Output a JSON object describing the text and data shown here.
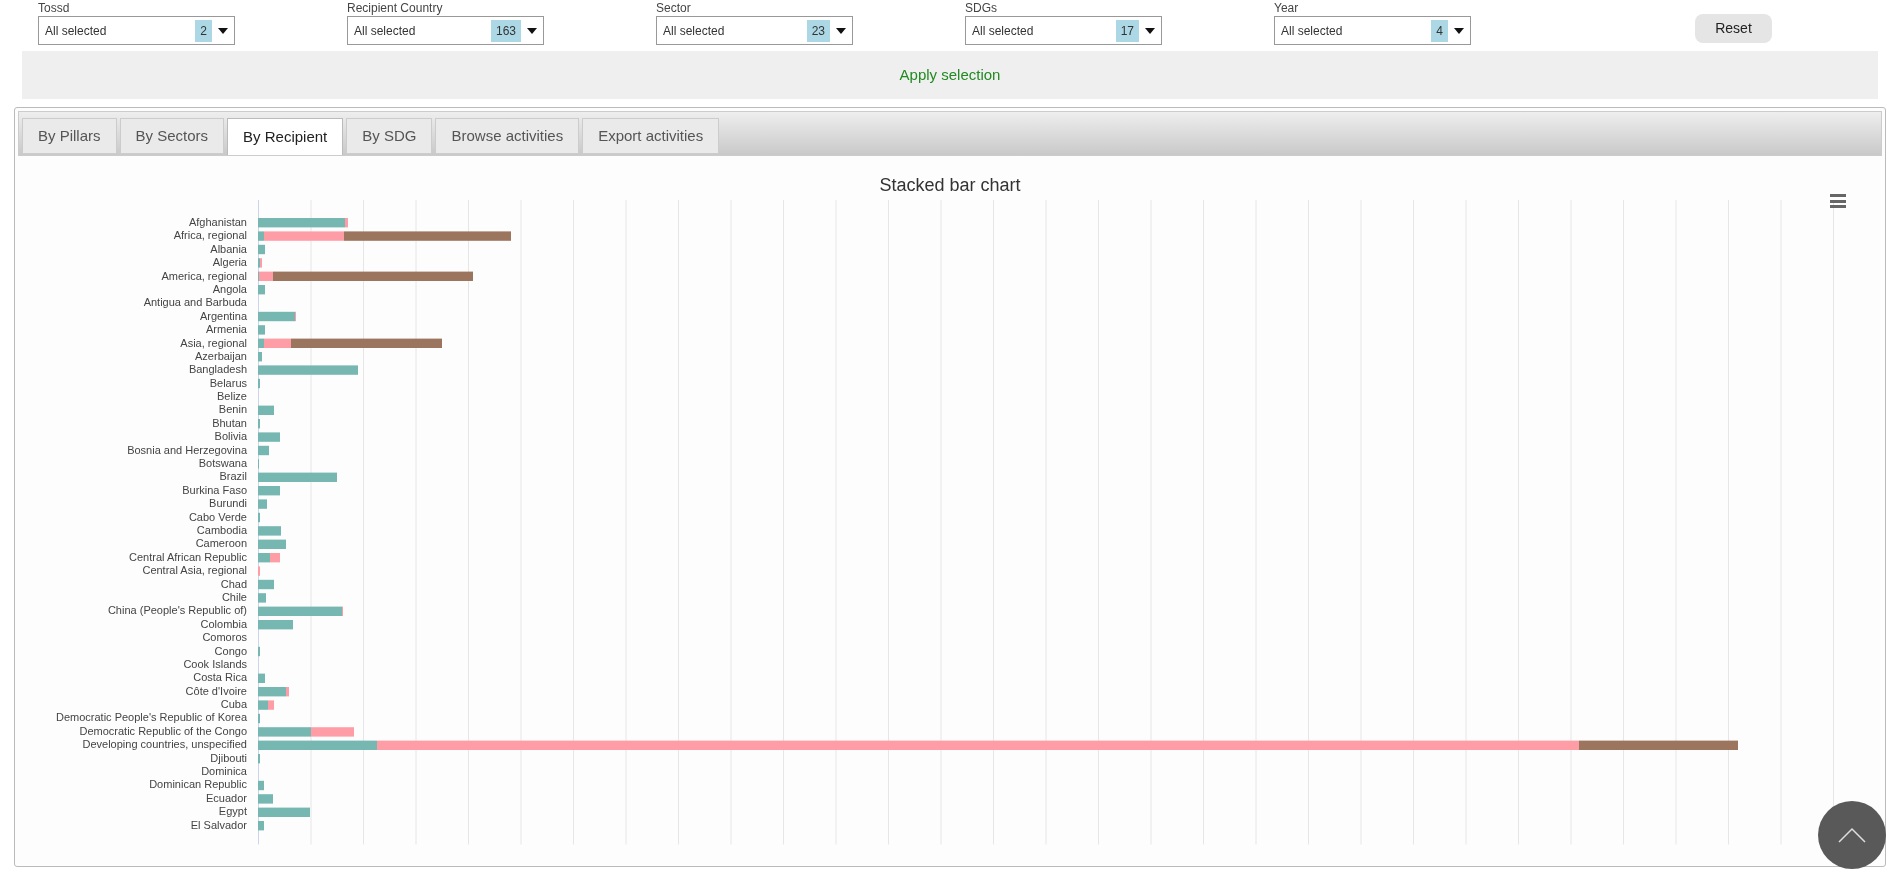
{
  "filters": [
    {
      "label": "Tossd",
      "value": "All selected",
      "count": "2"
    },
    {
      "label": "Recipient Country",
      "value": "All selected",
      "count": "163"
    },
    {
      "label": "Sector",
      "value": "All selected",
      "count": "23"
    },
    {
      "label": "SDGs",
      "value": "All selected",
      "count": "17"
    },
    {
      "label": "Year",
      "value": "All selected",
      "count": "4"
    }
  ],
  "reset_button": "Reset",
  "apply_button": "Apply selection",
  "tabs": [
    {
      "label": "By Pillars",
      "selected": false
    },
    {
      "label": "By Sectors",
      "selected": false
    },
    {
      "label": "By Recipient",
      "selected": true
    },
    {
      "label": "By SDG",
      "selected": false
    },
    {
      "label": "Browse activities",
      "selected": false
    },
    {
      "label": "Export activities",
      "selected": false
    }
  ],
  "chart": {
    "title": "Stacked bar chart",
    "row_labels": [
      "Afghanistan",
      "Africa, regional",
      "Albania",
      "Algeria",
      "America, regional",
      "Angola",
      "Antigua and Barbuda",
      "Argentina",
      "Armenia",
      "Asia, regional",
      "Azerbaijan",
      "Bangladesh",
      "Belarus",
      "Belize",
      "Benin",
      "Bhutan",
      "Bolivia",
      "Bosnia and Herzegovina",
      "Botswana",
      "Brazil",
      "Burkina Faso",
      "Burundi",
      "Cabo Verde",
      "Cambodia",
      "Cameroon",
      "Central African Republic",
      "Central Asia, regional",
      "Chad",
      "Chile",
      "China (People's Republic of)",
      "Colombia",
      "Comoros",
      "Congo",
      "Cook Islands",
      "Costa Rica",
      "Côte d'Ivoire",
      "Cuba",
      "Democratic People's Republic of Korea",
      "Democratic Republic of the Congo",
      "Developing countries, unspecified",
      "Djibouti",
      "Dominica",
      "Dominican Republic",
      "Ecuador",
      "Egypt",
      "El Salvador"
    ]
  }
}
